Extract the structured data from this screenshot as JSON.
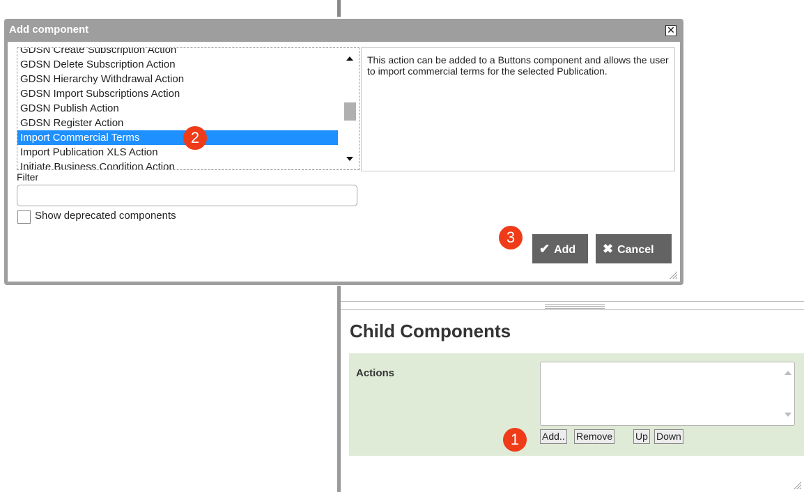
{
  "dialog": {
    "title": "Add component",
    "close_glyph": "✕",
    "components": [
      "GDSN Create Subscription Action",
      "GDSN Delete Subscription Action",
      "GDSN Hierarchy Withdrawal Action",
      "GDSN Import Subscriptions Action",
      "GDSN Publish Action",
      "GDSN Register Action",
      "Import Commercial Terms",
      "Import Publication XLS Action",
      "Initiate Business Condition Action"
    ],
    "selected_component": "Import Commercial Terms",
    "description": "This action can be added to a Buttons component and allows the user to import commercial terms for the selected Publication.",
    "filter_label": "Filter",
    "filter_value": "",
    "show_deprecated_label": "Show deprecated components",
    "show_deprecated_checked": false,
    "add_label": "Add",
    "add_icon": "checkmark-icon",
    "cancel_label": "Cancel",
    "cancel_icon": "x-icon"
  },
  "child_components": {
    "title": "Child Components",
    "actions_label": "Actions",
    "actions_items": [],
    "buttons": {
      "add": "Add..",
      "remove": "Remove",
      "up": "Up",
      "down": "Down"
    }
  },
  "badges": {
    "one": "1",
    "two": "2",
    "three": "3"
  },
  "colors": {
    "selection": "#1e90ff",
    "badge": "#ef3b18",
    "dialog_frame": "#9e9e9e",
    "button_dark": "#636363",
    "actions_bg": "#dfead7"
  }
}
